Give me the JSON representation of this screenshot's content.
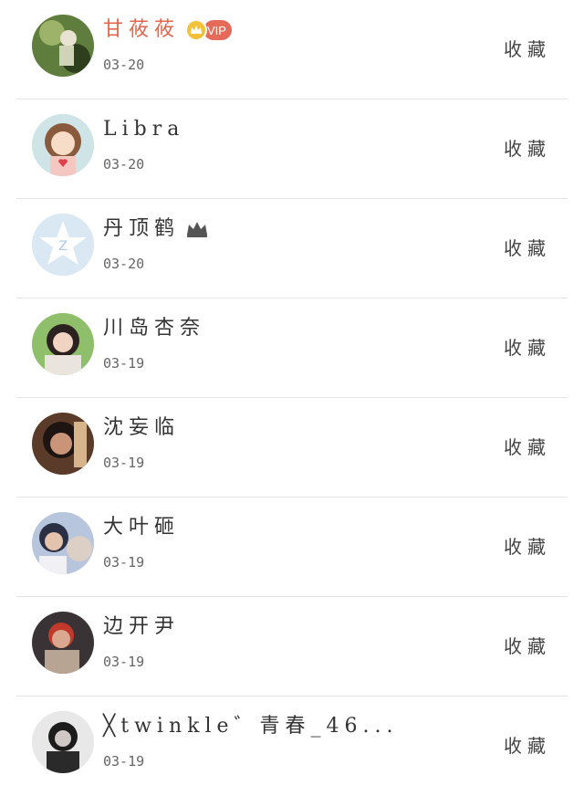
{
  "users": [
    {
      "name": "甘莜莜",
      "date": "03-20",
      "vip_label": "VIP",
      "action_label": "收藏"
    },
    {
      "name": "Libra",
      "date": "03-20",
      "action_label": "收藏"
    },
    {
      "name": "丹顶鹤",
      "date": "03-20",
      "action_label": "收藏"
    },
    {
      "name": "川岛杏奈",
      "date": "03-19",
      "action_label": "收藏"
    },
    {
      "name": "沈妄临",
      "date": "03-19",
      "action_label": "收藏"
    },
    {
      "name": "大叶砸",
      "date": "03-19",
      "action_label": "收藏"
    },
    {
      "name": "边开尹",
      "date": "03-19",
      "action_label": "收藏"
    },
    {
      "name": "╳twinkle゛青春_46...",
      "date": "03-19",
      "action_label": "收藏"
    }
  ],
  "colors": {
    "vip_name": "#e0664c",
    "vip_pill": "#e66a5a",
    "divider": "#e5e5e5"
  }
}
